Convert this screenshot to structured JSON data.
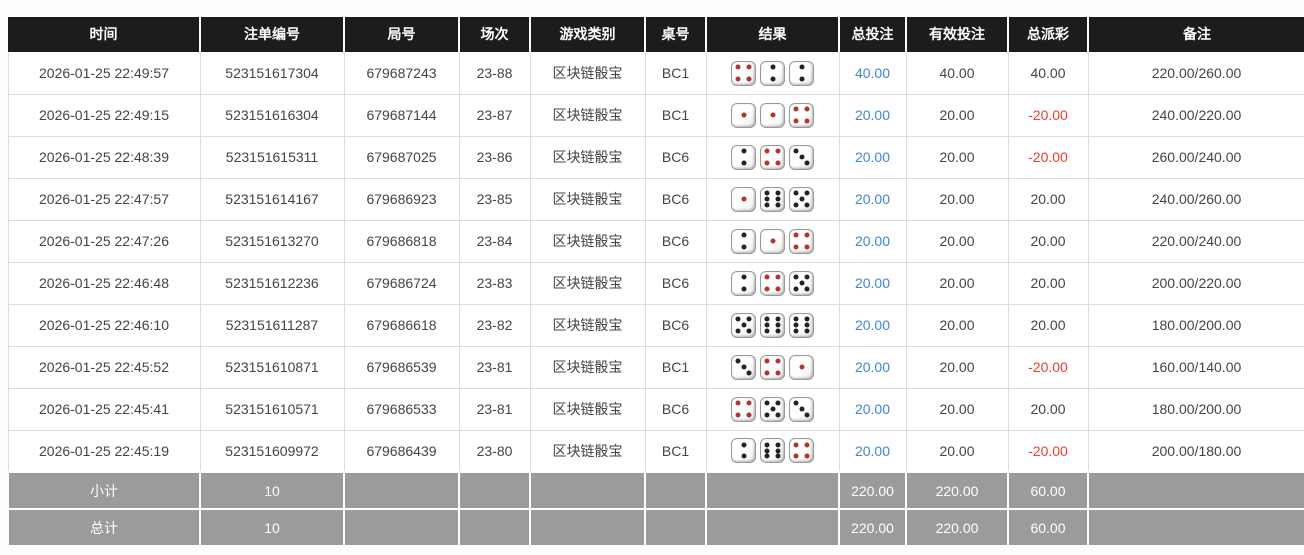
{
  "colors": {
    "header_bg": "#1c1c1c",
    "footer_bg": "#9b9b9b",
    "total_bet_blue": "#4285d8",
    "negative_red": "#ef3b33",
    "pip_black": "#222222",
    "pip_red": "#b23432"
  },
  "table": {
    "columns": [
      {
        "key": "time",
        "label": "时间"
      },
      {
        "key": "bet_id",
        "label": "注单编号"
      },
      {
        "key": "round_no",
        "label": "局号"
      },
      {
        "key": "session",
        "label": "场次"
      },
      {
        "key": "game_type",
        "label": "游戏类别"
      },
      {
        "key": "table_no",
        "label": "桌号"
      },
      {
        "key": "result",
        "label": "结果"
      },
      {
        "key": "total_bet",
        "label": "总投注"
      },
      {
        "key": "valid_bet",
        "label": "有效投注"
      },
      {
        "key": "total_payout",
        "label": "总派彩"
      },
      {
        "key": "remark",
        "label": "备注"
      }
    ],
    "rows": [
      {
        "time": "2026-01-25 22:49:57",
        "bet_id": "523151617304",
        "round_no": "679687243",
        "session": "23-88",
        "game_type": "区块链骰宝",
        "table_no": "BC1",
        "dice": [
          4,
          2,
          2
        ],
        "total_bet": "40.00",
        "valid_bet": "40.00",
        "total_payout": "40.00",
        "remark": "220.00/260.00"
      },
      {
        "time": "2026-01-25 22:49:15",
        "bet_id": "523151616304",
        "round_no": "679687144",
        "session": "23-87",
        "game_type": "区块链骰宝",
        "table_no": "BC1",
        "dice": [
          1,
          1,
          4
        ],
        "total_bet": "20.00",
        "valid_bet": "20.00",
        "total_payout": "-20.00",
        "remark": "240.00/220.00"
      },
      {
        "time": "2026-01-25 22:48:39",
        "bet_id": "523151615311",
        "round_no": "679687025",
        "session": "23-86",
        "game_type": "区块链骰宝",
        "table_no": "BC6",
        "dice": [
          2,
          4,
          3
        ],
        "total_bet": "20.00",
        "valid_bet": "20.00",
        "total_payout": "-20.00",
        "remark": "260.00/240.00"
      },
      {
        "time": "2026-01-25 22:47:57",
        "bet_id": "523151614167",
        "round_no": "679686923",
        "session": "23-85",
        "game_type": "区块链骰宝",
        "table_no": "BC6",
        "dice": [
          1,
          6,
          5
        ],
        "total_bet": "20.00",
        "valid_bet": "20.00",
        "total_payout": "20.00",
        "remark": "240.00/260.00"
      },
      {
        "time": "2026-01-25 22:47:26",
        "bet_id": "523151613270",
        "round_no": "679686818",
        "session": "23-84",
        "game_type": "区块链骰宝",
        "table_no": "BC6",
        "dice": [
          2,
          1,
          4
        ],
        "total_bet": "20.00",
        "valid_bet": "20.00",
        "total_payout": "20.00",
        "remark": "220.00/240.00"
      },
      {
        "time": "2026-01-25 22:46:48",
        "bet_id": "523151612236",
        "round_no": "679686724",
        "session": "23-83",
        "game_type": "区块链骰宝",
        "table_no": "BC6",
        "dice": [
          2,
          4,
          5
        ],
        "total_bet": "20.00",
        "valid_bet": "20.00",
        "total_payout": "20.00",
        "remark": "200.00/220.00"
      },
      {
        "time": "2026-01-25 22:46:10",
        "bet_id": "523151611287",
        "round_no": "679686618",
        "session": "23-82",
        "game_type": "区块链骰宝",
        "table_no": "BC6",
        "dice": [
          5,
          6,
          6
        ],
        "total_bet": "20.00",
        "valid_bet": "20.00",
        "total_payout": "20.00",
        "remark": "180.00/200.00"
      },
      {
        "time": "2026-01-25 22:45:52",
        "bet_id": "523151610871",
        "round_no": "679686539",
        "session": "23-81",
        "game_type": "区块链骰宝",
        "table_no": "BC1",
        "dice": [
          3,
          4,
          1
        ],
        "total_bet": "20.00",
        "valid_bet": "20.00",
        "total_payout": "-20.00",
        "remark": "160.00/140.00"
      },
      {
        "time": "2026-01-25 22:45:41",
        "bet_id": "523151610571",
        "round_no": "679686533",
        "session": "23-81",
        "game_type": "区块链骰宝",
        "table_no": "BC6",
        "dice": [
          4,
          5,
          3
        ],
        "total_bet": "20.00",
        "valid_bet": "20.00",
        "total_payout": "20.00",
        "remark": "180.00/200.00"
      },
      {
        "time": "2026-01-25 22:45:19",
        "bet_id": "523151609972",
        "round_no": "679686439",
        "session": "23-80",
        "game_type": "区块链骰宝",
        "table_no": "BC1",
        "dice": [
          2,
          6,
          4
        ],
        "total_bet": "20.00",
        "valid_bet": "20.00",
        "total_payout": "-20.00",
        "remark": "200.00/180.00"
      }
    ],
    "subtotal": {
      "label": "小计",
      "count": "10",
      "total_bet": "220.00",
      "valid_bet": "220.00",
      "total_payout": "60.00"
    },
    "total": {
      "label": "总计",
      "count": "10",
      "total_bet": "220.00",
      "valid_bet": "220.00",
      "total_payout": "60.00"
    }
  }
}
